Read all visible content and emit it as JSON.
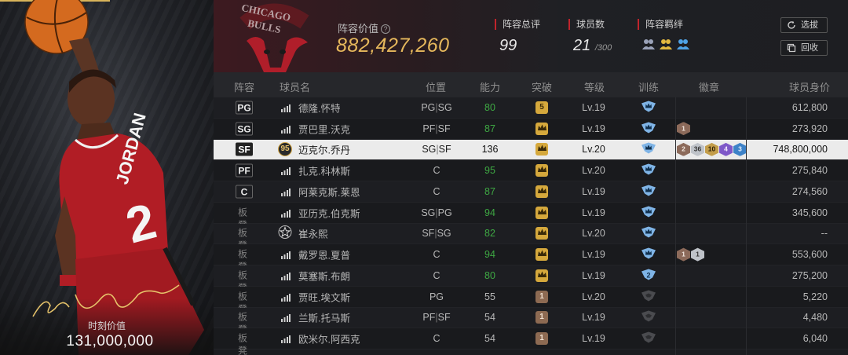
{
  "card": {
    "value_label": "时刻价值",
    "value": "131,000,000"
  },
  "header": {
    "lineup_label": "阵容价值",
    "lineup_value": "882,427,260",
    "rating_label": "阵容总评",
    "rating_value": "99",
    "count_label": "球员数",
    "count_value": "21",
    "count_max": "/300",
    "bond_label": "阵容羁绊",
    "btn_select": "选拔",
    "btn_recycle": "回收"
  },
  "table": {
    "columns": [
      "阵容",
      "球员名",
      "位置",
      "能力",
      "突破",
      "等级",
      "训练",
      "徽章",
      "球员身价"
    ],
    "rows": [
      {
        "slot": "PG",
        "bench": false,
        "icon": "bars",
        "name": "德隆.怀特",
        "pos1": "PG",
        "pos2": "SG",
        "ability": "80",
        "green": true,
        "breakthrough": "5",
        "break_type": "gold",
        "level": "Lv.19",
        "train": "crown",
        "badges": [],
        "value": "612,800"
      },
      {
        "slot": "SG",
        "bench": false,
        "icon": "bars",
        "name": "贾巴里.沃克",
        "pos1": "PF",
        "pos2": "SF",
        "ability": "87",
        "green": true,
        "breakthrough": "crown",
        "break_type": "gold",
        "level": "Lv.19",
        "train": "crown",
        "badges": [
          {
            "t": "b1",
            "v": "1"
          }
        ],
        "value": "273,920"
      },
      {
        "slot": "SF",
        "bench": false,
        "selected": true,
        "icon": "95",
        "name": "迈克尔.乔丹",
        "pos1": "SG",
        "pos2": "SF",
        "ability": "136",
        "green": false,
        "breakthrough": "crown",
        "break_type": "gold",
        "level": "Lv.20",
        "train": "crown",
        "badges": [
          {
            "t": "b1",
            "v": "2"
          },
          {
            "t": "s1",
            "v": "36"
          },
          {
            "t": "gd",
            "v": "10"
          },
          {
            "t": "pu",
            "v": "4"
          },
          {
            "t": "bl",
            "v": "3"
          }
        ],
        "value": "748,800,000"
      },
      {
        "slot": "PF",
        "bench": false,
        "icon": "bars",
        "name": "扎克.科林斯",
        "pos1": "C",
        "pos2": "",
        "ability": "95",
        "green": true,
        "breakthrough": "crown",
        "break_type": "gold",
        "level": "Lv.20",
        "train": "crown",
        "badges": [],
        "value": "275,840"
      },
      {
        "slot": "C",
        "bench": false,
        "icon": "bars",
        "name": "阿莱克斯.莱恩",
        "pos1": "C",
        "pos2": "",
        "ability": "87",
        "green": true,
        "breakthrough": "crown",
        "break_type": "gold",
        "level": "Lv.19",
        "train": "crown",
        "badges": [],
        "value": "274,560"
      },
      {
        "slot": "板凳",
        "bench": true,
        "icon": "bars",
        "name": "亚历克.伯克斯",
        "pos1": "SG",
        "pos2": "PG",
        "ability": "94",
        "green": true,
        "breakthrough": "crown",
        "break_type": "gold",
        "level": "Lv.19",
        "train": "crown",
        "badges": [],
        "value": "345,600"
      },
      {
        "slot": "板凳",
        "bench": true,
        "icon": "star",
        "name": "崔永熙",
        "pos1": "SF",
        "pos2": "SG",
        "ability": "82",
        "green": true,
        "breakthrough": "crown",
        "break_type": "gold",
        "level": "Lv.20",
        "train": "crown",
        "badges": [],
        "value": "--"
      },
      {
        "slot": "板凳",
        "bench": true,
        "icon": "bars",
        "name": "戴罗恩.夏普",
        "pos1": "C",
        "pos2": "",
        "ability": "94",
        "green": true,
        "breakthrough": "crown",
        "break_type": "gold",
        "level": "Lv.19",
        "train": "crown",
        "badges": [
          {
            "t": "b1",
            "v": "1"
          },
          {
            "t": "s1",
            "v": "1"
          }
        ],
        "value": "553,600"
      },
      {
        "slot": "板凳",
        "bench": true,
        "icon": "bars",
        "name": "莫塞斯.布朗",
        "pos1": "C",
        "pos2": "",
        "ability": "80",
        "green": true,
        "breakthrough": "crown",
        "break_type": "gold",
        "level": "Lv.19",
        "train": "2",
        "badges": [],
        "value": "275,200"
      },
      {
        "slot": "板凳",
        "bench": true,
        "icon": "bars",
        "name": "贾旺.埃文斯",
        "pos1": "PG",
        "pos2": "",
        "ability": "55",
        "green": false,
        "breakthrough": "1",
        "break_type": "bronze",
        "level": "Lv.20",
        "train": "dark",
        "badges": [],
        "value": "5,220"
      },
      {
        "slot": "板凳",
        "bench": true,
        "icon": "bars",
        "name": "兰斯.托马斯",
        "pos1": "PF",
        "pos2": "SF",
        "ability": "54",
        "green": false,
        "breakthrough": "1",
        "break_type": "bronze",
        "level": "Lv.19",
        "train": "dark",
        "badges": [],
        "value": "4,480"
      },
      {
        "slot": "板凳",
        "bench": true,
        "icon": "bars",
        "name": "欧米尔.阿西克",
        "pos1": "C",
        "pos2": "",
        "ability": "54",
        "green": false,
        "breakthrough": "1",
        "break_type": "bronze",
        "level": "Lv.19",
        "train": "dark",
        "badges": [],
        "value": "6,040"
      }
    ]
  },
  "colors": {
    "gold": "#e6b85c",
    "green": "#3ea843",
    "accent_red": "#c0242c"
  }
}
